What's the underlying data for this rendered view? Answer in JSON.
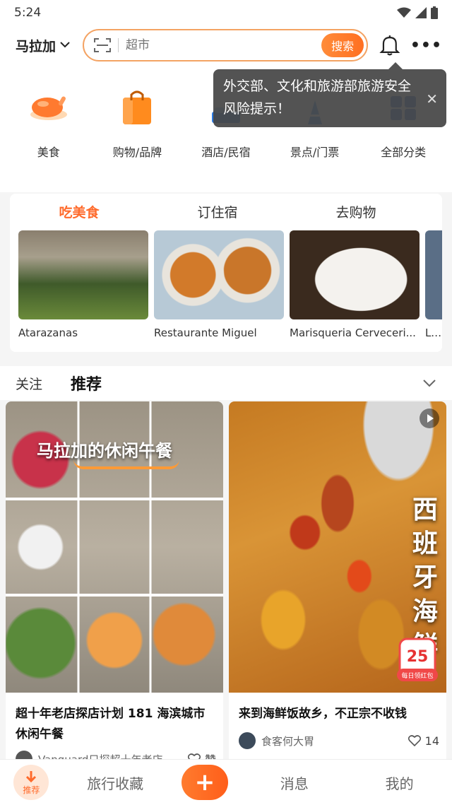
{
  "status_bar": {
    "time": "5:24"
  },
  "header": {
    "city": "马拉加",
    "search_placeholder": "超市",
    "search_button": "搜索"
  },
  "categories": [
    {
      "label": "美食",
      "icon": "roast-chicken-icon",
      "color": "#ff7a2f"
    },
    {
      "label": "购物/品牌",
      "icon": "shopping-bag-icon",
      "color": "#ff8b1e"
    },
    {
      "label": "酒店/民宿",
      "icon": "hotel-icon",
      "color": "#2b7be4"
    },
    {
      "label": "景点/门票",
      "icon": "landmark-icon",
      "color": "#3a8be8"
    },
    {
      "label": "全部分类",
      "icon": "grid-icon",
      "color": "#3d6fd6"
    }
  ],
  "tooltip": {
    "text": "外交部、文化和旅游部旅游安全风险提示！"
  },
  "recommend": {
    "tabs": [
      "吃美食",
      "订住宿",
      "去购物"
    ],
    "items": [
      {
        "name": "Atarazanas"
      },
      {
        "name": "Restaurante Miguel"
      },
      {
        "name": "Marisqueria Cerveceri..."
      },
      {
        "name": "Lo C"
      }
    ]
  },
  "feed": {
    "tabs": [
      "关注",
      "推荐"
    ],
    "posts": [
      {
        "overlay": "马拉加的休闲午餐",
        "title": "超十年老店探店计划 181 海滨城市休闲午餐",
        "author": "Vanguard只探超十年老店",
        "likes": "赞"
      },
      {
        "overlay": "西班牙海鲜",
        "title": "来到海鲜饭故乡，不正宗不收钱",
        "author": "食客何大胃",
        "likes": "14",
        "badge_number": "25",
        "badge_text": "每日领红包"
      }
    ]
  },
  "bottom_nav": {
    "home": "推荐",
    "favorites": "旅行收藏",
    "messages": "消息",
    "profile": "我的"
  }
}
